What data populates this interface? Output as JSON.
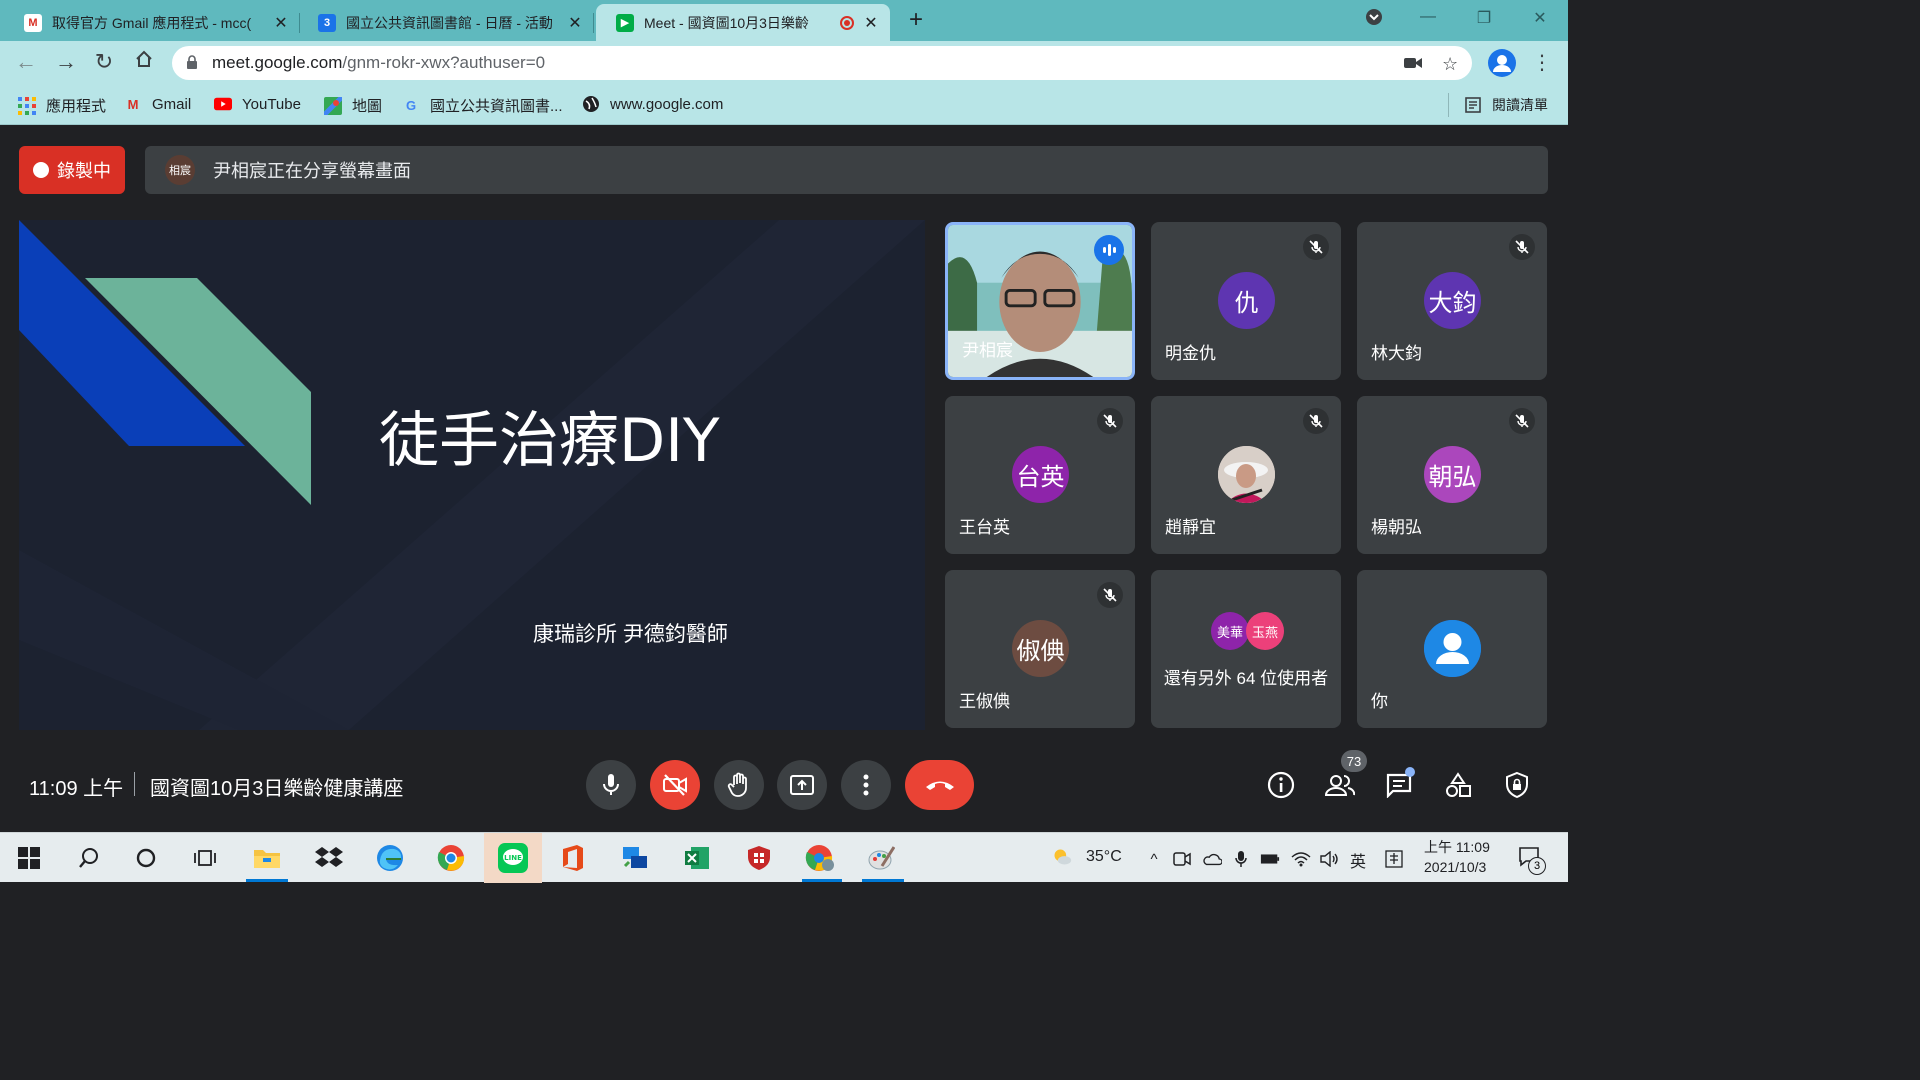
{
  "browser": {
    "tabs": [
      {
        "title": "取得官方 Gmail 應用程式 - mcc(",
        "close": "✕"
      },
      {
        "title": "國立公共資訊圖書館 - 日曆 - 活動",
        "close": "✕"
      },
      {
        "title": "Meet - 國資圖10月3日樂齡",
        "close": "✕"
      }
    ],
    "new_tab": "+",
    "url_host": "meet.google.com",
    "url_path": "/gnm-rokr-xwx?authuser=0"
  },
  "bookmarks": [
    {
      "label": "應用程式",
      "icon": "apps-grid-icon"
    },
    {
      "label": "Gmail",
      "icon": "gmail-icon"
    },
    {
      "label": "YouTube",
      "icon": "youtube-icon"
    },
    {
      "label": "地圖",
      "icon": "maps-icon"
    },
    {
      "label": "國立公共資訊圖書...",
      "icon": "google-icon"
    },
    {
      "label": "www.google.com",
      "icon": "globe-icon"
    }
  ],
  "reading_list": "閱讀清單",
  "meet": {
    "recording_label": "錄製中",
    "presenter_avatar": "相宸",
    "share_notice": "尹相宸正在分享螢幕畫面",
    "slide": {
      "title": "徒手治療DIY",
      "subtitle": "康瑞診所 尹德鈞醫師",
      "colors": {
        "background": "#1c2230",
        "blue": "#0a3fb8",
        "green": "#6cb39a"
      }
    },
    "participants": [
      {
        "name": "尹相宸",
        "initials": "",
        "color": "",
        "speaking": true,
        "muted": false
      },
      {
        "name": "明金仇",
        "initials": "仇",
        "color": "#5e35b1",
        "muted": true
      },
      {
        "name": "林大鈞",
        "initials": "大鈞",
        "color": "#5e35b1",
        "muted": true
      },
      {
        "name": "王台英",
        "initials": "台英",
        "color": "#8e24aa",
        "muted": true
      },
      {
        "name": "趙靜宜",
        "initials": "",
        "color": "",
        "muted": true
      },
      {
        "name": "楊朝弘",
        "initials": "朝弘",
        "color": "#ab47bc",
        "muted": true
      },
      {
        "name": "王俶倎",
        "initials": "俶倎",
        "color": "#6d4c41",
        "muted": true
      }
    ],
    "others": {
      "label": "還有另外 64 位使用者",
      "avatars": [
        "美華",
        "玉燕"
      ]
    },
    "self_label": "你",
    "clock": "11:09 上午",
    "meeting_title": "國資圖10月3日樂齡健康講座",
    "people_count": "73"
  },
  "taskbar": {
    "weather": "35°C",
    "ime": "英",
    "time": "上午 11:09",
    "date": "2021/10/3",
    "notifications": "3"
  }
}
